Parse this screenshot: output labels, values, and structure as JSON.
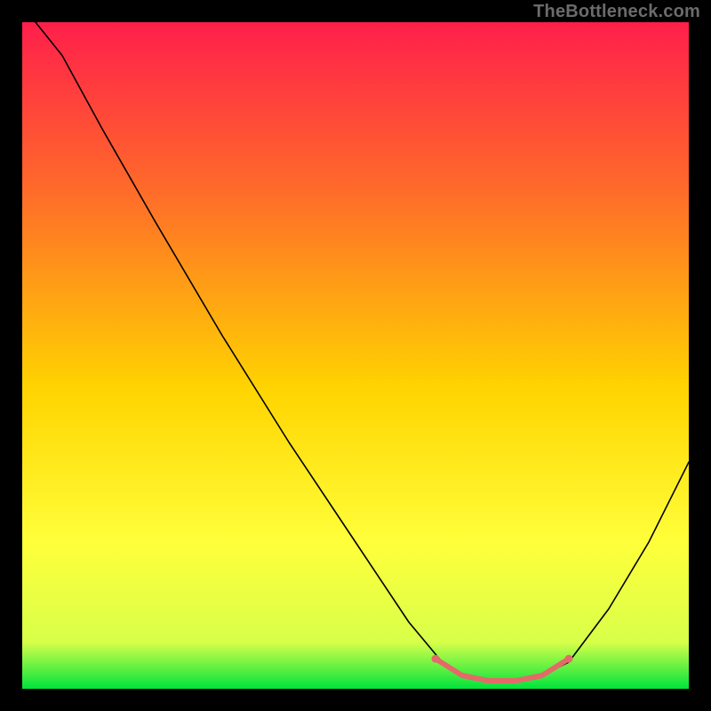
{
  "watermark": "TheBottleneck.com",
  "chart_data": {
    "type": "line",
    "title": "",
    "xlabel": "",
    "ylabel": "",
    "xlim": [
      0,
      100
    ],
    "ylim": [
      0,
      100
    ],
    "gradient_stops": [
      {
        "offset": 0,
        "color": "#ff1f4b"
      },
      {
        "offset": 25,
        "color": "#ff6a2a"
      },
      {
        "offset": 55,
        "color": "#ffd400"
      },
      {
        "offset": 78,
        "color": "#ffff3a"
      },
      {
        "offset": 93,
        "color": "#d8ff4a"
      },
      {
        "offset": 100,
        "color": "#00e43b"
      }
    ],
    "series": [
      {
        "name": "curve",
        "color": "#000000",
        "width": 1.6,
        "points": [
          {
            "x": 2,
            "y": 100
          },
          {
            "x": 6,
            "y": 95
          },
          {
            "x": 12,
            "y": 84
          },
          {
            "x": 20,
            "y": 70
          },
          {
            "x": 30,
            "y": 53
          },
          {
            "x": 40,
            "y": 37
          },
          {
            "x": 50,
            "y": 22
          },
          {
            "x": 58,
            "y": 10
          },
          {
            "x": 63,
            "y": 4
          },
          {
            "x": 67,
            "y": 1.5
          },
          {
            "x": 72,
            "y": 1
          },
          {
            "x": 77,
            "y": 1.5
          },
          {
            "x": 82,
            "y": 4
          },
          {
            "x": 88,
            "y": 12
          },
          {
            "x": 94,
            "y": 22
          },
          {
            "x": 100,
            "y": 34
          }
        ]
      },
      {
        "name": "highlight-band",
        "color": "#e46a6a",
        "width": 6,
        "points": [
          {
            "x": 62,
            "y": 4.5
          },
          {
            "x": 66,
            "y": 2
          },
          {
            "x": 70,
            "y": 1.2
          },
          {
            "x": 74,
            "y": 1.2
          },
          {
            "x": 78,
            "y": 2
          },
          {
            "x": 82,
            "y": 4.5
          }
        ]
      }
    ],
    "markers": [
      {
        "x": 62,
        "y": 4.5,
        "r": 4.5,
        "color": "#e46a6a"
      },
      {
        "x": 82,
        "y": 4.5,
        "r": 4.5,
        "color": "#e46a6a"
      }
    ]
  }
}
